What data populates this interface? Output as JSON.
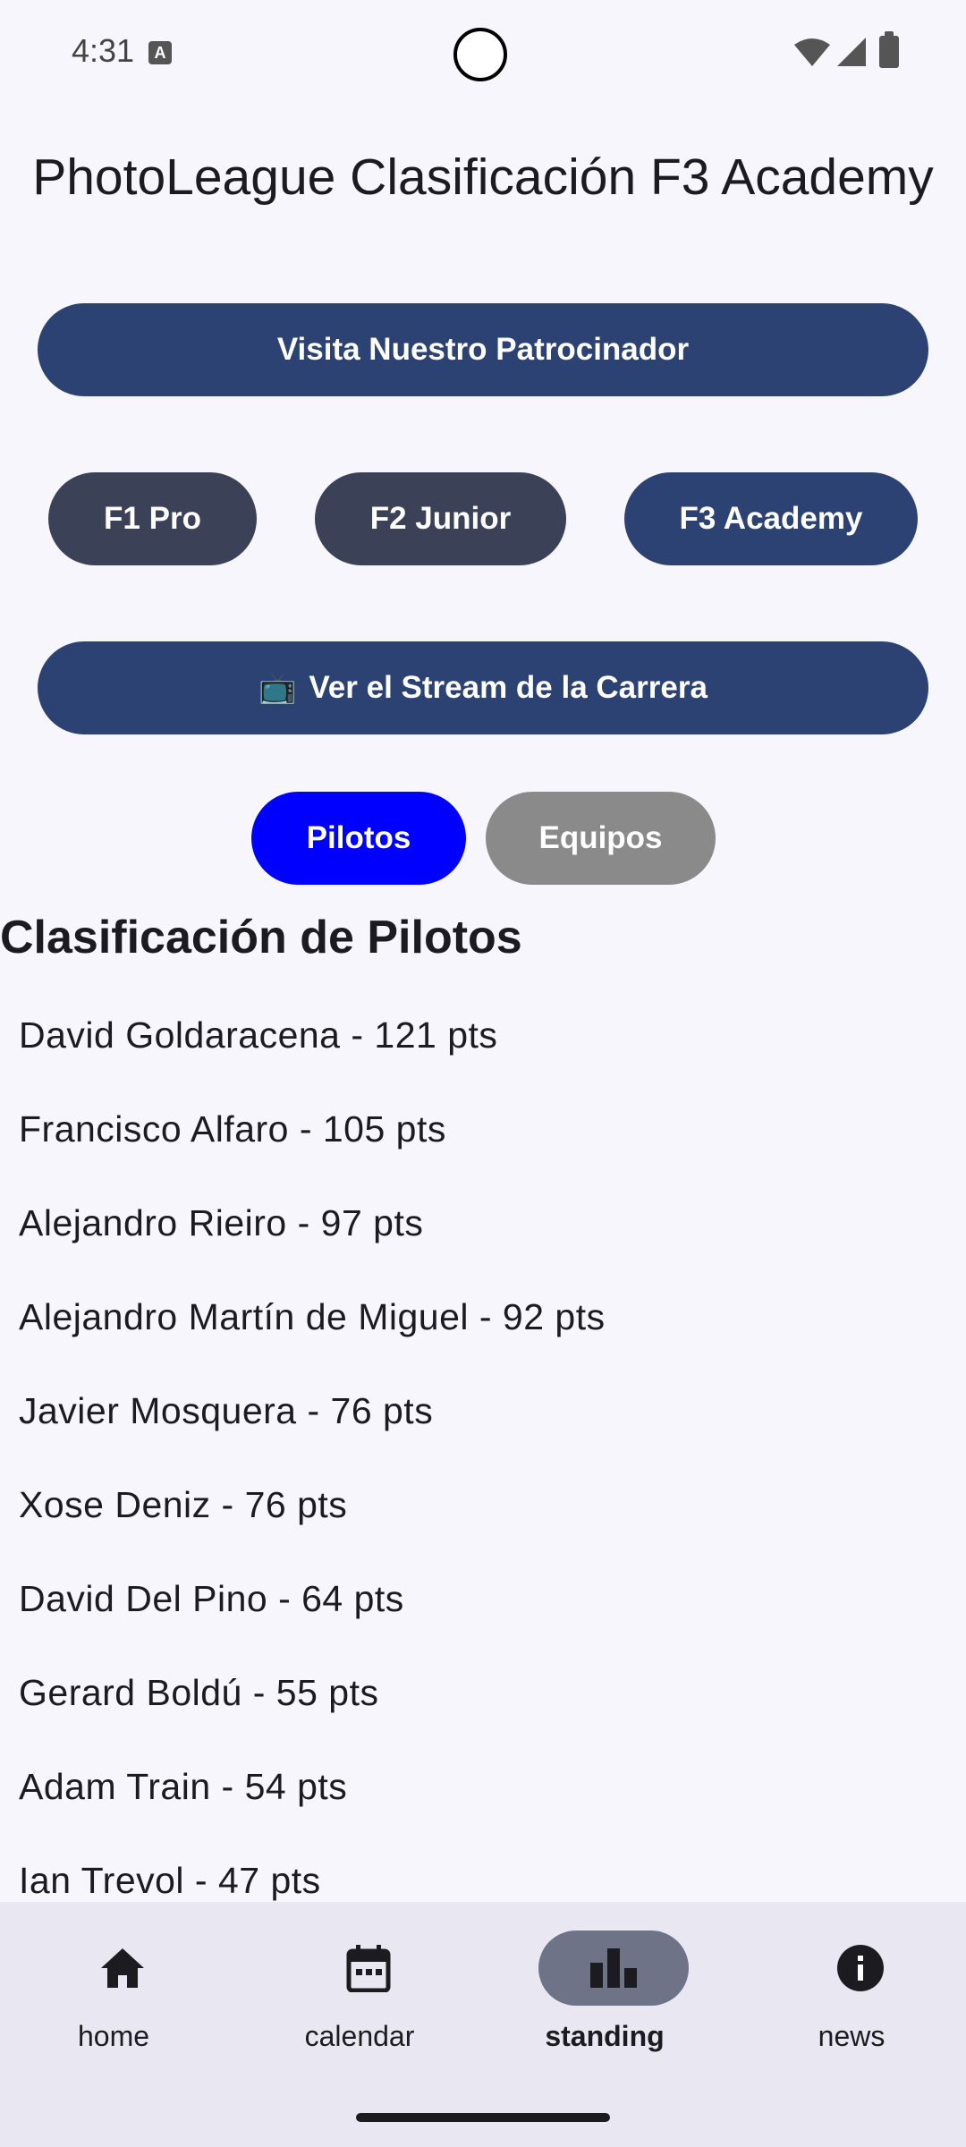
{
  "status_bar": {
    "time": "4:31"
  },
  "header": {
    "title": "PhotoLeague Clasificación F3 Academy"
  },
  "buttons": {
    "sponsor": "Visita Nuestro Patrocinador",
    "stream_emoji": "📺",
    "stream": "Ver el Stream de la Carrera"
  },
  "categories": [
    {
      "label": "F1 Pro"
    },
    {
      "label": "F2 Junior"
    },
    {
      "label": "F3 Academy",
      "selected": true
    }
  ],
  "toggle": {
    "pilotos": "Pilotos",
    "equipos": "Equipos",
    "selected": "Pilotos"
  },
  "section_title": "Clasificación de Pilotos",
  "standings": [
    "David Goldaracena - 121 pts",
    "Francisco Alfaro - 105 pts",
    "Alejandro Rieiro - 97 pts",
    "Alejandro Martín de Miguel - 92 pts",
    "Javier Mosquera - 76 pts",
    "Xose Deniz - 76 pts",
    "David Del Pino - 64 pts",
    "Gerard Boldú - 55 pts",
    "Adam Train - 54 pts",
    "Ian Trevol - 47 pts"
  ],
  "nav": {
    "items": [
      {
        "label": "home",
        "icon": "home-icon"
      },
      {
        "label": "calendar",
        "icon": "calendar-icon"
      },
      {
        "label": "standing",
        "icon": "bar-chart-icon",
        "active": true
      },
      {
        "label": "news",
        "icon": "info-icon"
      }
    ]
  },
  "colors": {
    "primary_button": "#2b4272",
    "secondary_button": "#3b4157",
    "toggle_active": "#0000ff",
    "toggle_inactive": "#8a8a8a",
    "nav_active_pill": "#6f7387"
  }
}
